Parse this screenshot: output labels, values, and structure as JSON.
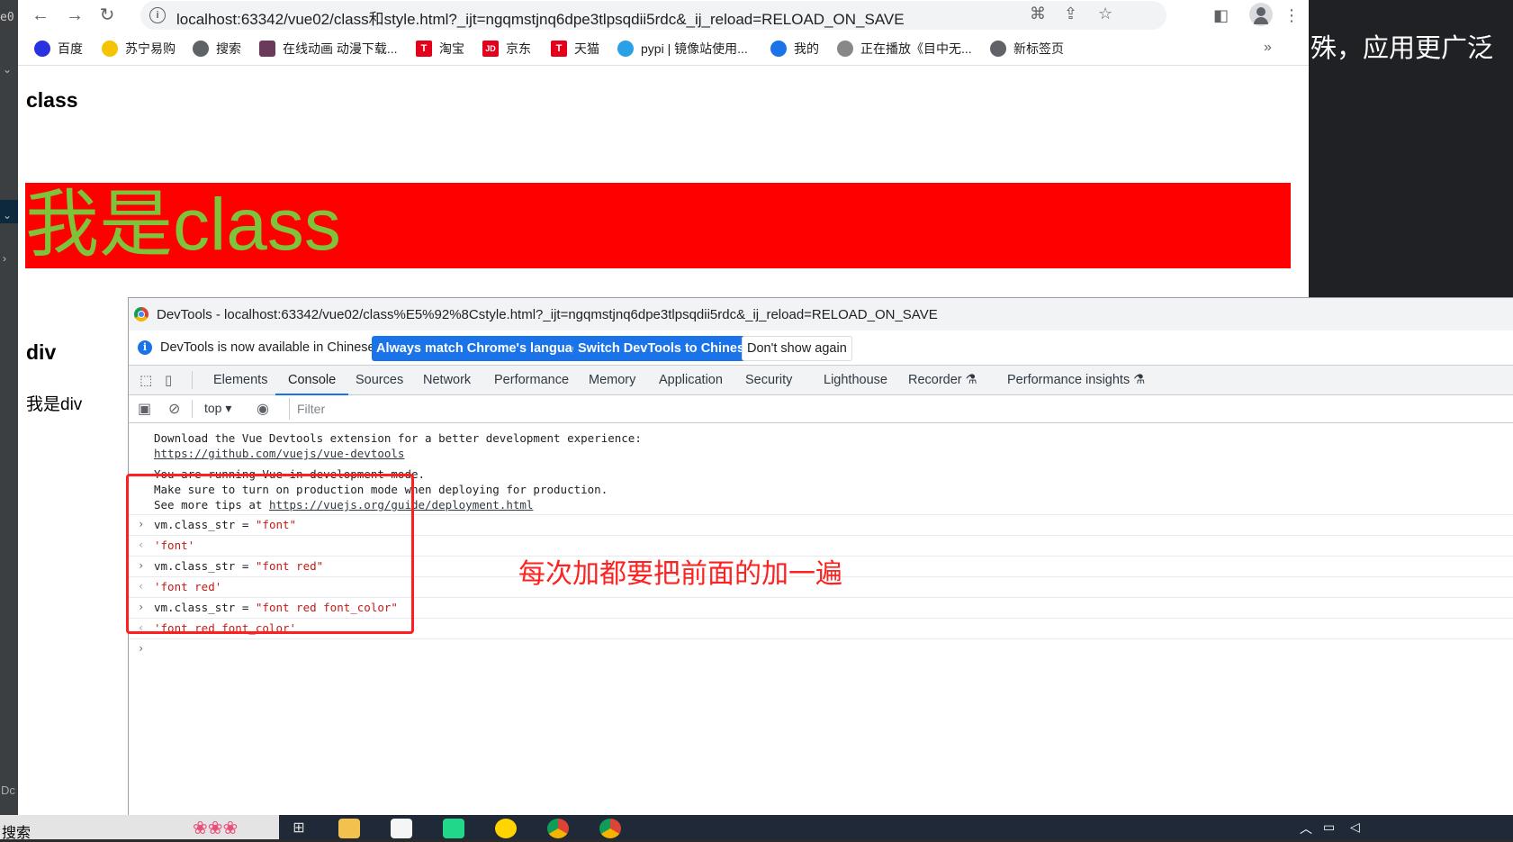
{
  "ide": {
    "tab_label": "e0",
    "bottom_label": "Dc"
  },
  "browser": {
    "url": "localhost:63342/vue02/class和style.html?_ijt=ngqmstjnq6dpe3tlpsqdii5rdc&_ij_reload=RELOAD_ON_SAVE",
    "bookmarks": [
      {
        "label": "百度",
        "icon": "baidu-paw-icon",
        "color": "#2932e1"
      },
      {
        "label": "苏宁易购",
        "icon": "suning-icon",
        "color": "#f5c300"
      },
      {
        "label": "搜索",
        "icon": "globe-icon",
        "color": "#5f6368"
      },
      {
        "label": "在线动画 动漫下载...",
        "icon": "anime-avatar-icon",
        "color": "#6b3a5a"
      },
      {
        "label": "淘宝",
        "icon": "tmall-t-icon",
        "color": "#e4001b"
      },
      {
        "label": "京东",
        "icon": "jd-icon",
        "color": "#e4001b"
      },
      {
        "label": "天猫",
        "icon": "tmall-t-icon",
        "color": "#e4001b"
      },
      {
        "label": "pypi | 镜像站使用...",
        "icon": "bird-icon",
        "color": "#2aa1e6"
      },
      {
        "label": "我的",
        "icon": "swirl-icon",
        "color": "#1a73e8"
      },
      {
        "label": "正在播放《目中无...",
        "icon": "film-reel-icon",
        "color": "#888888"
      },
      {
        "label": "新标签页",
        "icon": "globe-icon",
        "color": "#5f6368"
      }
    ],
    "more_label": "»"
  },
  "page": {
    "heading_class": "class",
    "red_text": "我是class",
    "heading_div": "div",
    "div_text": "我是div",
    "red_bg": "#ff0000",
    "text_color": "#7ec339"
  },
  "right_panel": {
    "text": "殊，应用更广泛"
  },
  "devtools": {
    "title": "DevTools - localhost:63342/vue02/class%E5%92%8Cstyle.html?_ijt=ngqmstjnq6dpe3tlpsqdii5rdc&_ij_reload=RELOAD_ON_SAVE",
    "infobar": {
      "message": "DevTools is now available in Chinese!",
      "btn_match": "Always match Chrome's language",
      "btn_switch": "Switch DevTools to Chinese",
      "btn_dismiss": "Don't show again"
    },
    "tabs": [
      "Elements",
      "Console",
      "Sources",
      "Network",
      "Performance",
      "Memory",
      "Application",
      "Security",
      "Lighthouse",
      "Recorder",
      "Performance insights"
    ],
    "active_tab": "Console",
    "console_bar": {
      "context": "top",
      "filter_placeholder": "Filter"
    },
    "messages": {
      "vue_devtools_line": "Download the Vue Devtools extension for a better development experience:",
      "vue_devtools_link": "https://github.com/vuejs/vue-devtools",
      "dev_mode_1": "You are running Vue in development mode.",
      "dev_mode_2": "Make sure to turn on production mode when deploying for production.",
      "dev_mode_3_prefix": "See more tips at ",
      "dev_mode_3_link": "https://vuejs.org/guide/deployment.html"
    },
    "commands": [
      {
        "input_prefix": "vm.class_str = ",
        "input_str": "\"font\"",
        "result": "'font'"
      },
      {
        "input_prefix": "vm.class_str = ",
        "input_str": "\"font red\"",
        "result": "'font red'"
      },
      {
        "input_prefix": "vm.class_str = ",
        "input_str": "\"font red font_color\"",
        "result": "'font red font_color'"
      }
    ],
    "annotation": "每次加都要把前面的加一遍"
  },
  "taskbar": {
    "search_label": "搜索"
  }
}
